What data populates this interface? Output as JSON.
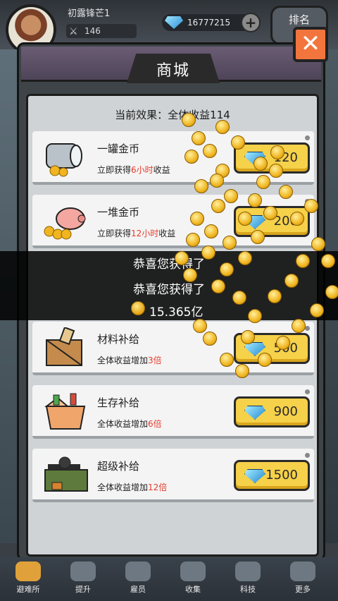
{
  "hud": {
    "player_name": "初露锋芒1",
    "power": "146",
    "gems": "16777215",
    "plus_label": "+",
    "rank_label": "排名"
  },
  "shop": {
    "title": "商城",
    "close_label": "✕",
    "effect_line": "当前效果：全体收益114",
    "items": [
      {
        "title": "一罐金币",
        "desc_pre": "立即获得",
        "desc_hl": "6小时",
        "desc_post": "收益",
        "price": "120",
        "icon": "coin-jar-icon"
      },
      {
        "title": "一堆金币",
        "desc_pre": "立即获得",
        "desc_hl": "12小时",
        "desc_post": "收益",
        "price": "200",
        "icon": "piggy-bank-icon"
      },
      {
        "title": "材料补给",
        "desc_pre": "全体收益增加",
        "desc_hl": "3倍",
        "desc_post": "",
        "price": "500",
        "icon": "supply-crate-icon"
      },
      {
        "title": "生存补给",
        "desc_pre": "全体收益增加",
        "desc_hl": "6倍",
        "desc_post": "",
        "price": "900",
        "icon": "survival-box-icon"
      },
      {
        "title": "超级补给",
        "desc_pre": "全体收益增加",
        "desc_hl": "12倍",
        "desc_post": "",
        "price": "1500",
        "icon": "weapon-case-icon"
      }
    ]
  },
  "reward": {
    "line1": "恭喜您获得了",
    "line2": "恭喜您获得了",
    "amount": "15.365亿"
  },
  "nav": [
    {
      "label": "避难所",
      "icon": "shelter-icon"
    },
    {
      "label": "提升",
      "icon": "hammer-icon"
    },
    {
      "label": "雇员",
      "icon": "employee-icon"
    },
    {
      "label": "收集",
      "icon": "trophy-icon"
    },
    {
      "label": "科技",
      "icon": "tech-icon"
    },
    {
      "label": "更多",
      "icon": "more-icon"
    }
  ],
  "colors": {
    "accent_yellow": "#f6d14a",
    "highlight_red": "#e53b2c",
    "close_orange": "#f1753d"
  }
}
